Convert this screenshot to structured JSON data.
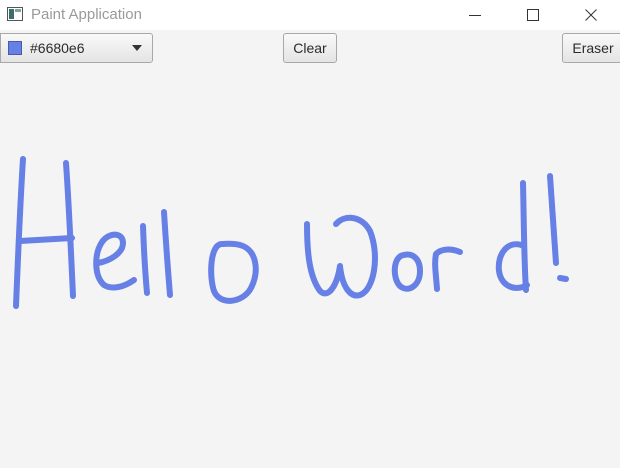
{
  "window": {
    "title": "Paint Application",
    "icon": "app-window-icon",
    "controls": [
      "minimize-icon",
      "maximize-icon",
      "close-icon"
    ]
  },
  "toolbar": {
    "color_picker": {
      "selected_value": "#6680e6",
      "swatch_color": "#6680e6"
    },
    "clear_label": "Clear",
    "eraser_label": "Eraser"
  },
  "canvas": {
    "background": "#f4f4f4",
    "stroke_color": "#6680e6",
    "drawn_text": "Hello World!"
  }
}
